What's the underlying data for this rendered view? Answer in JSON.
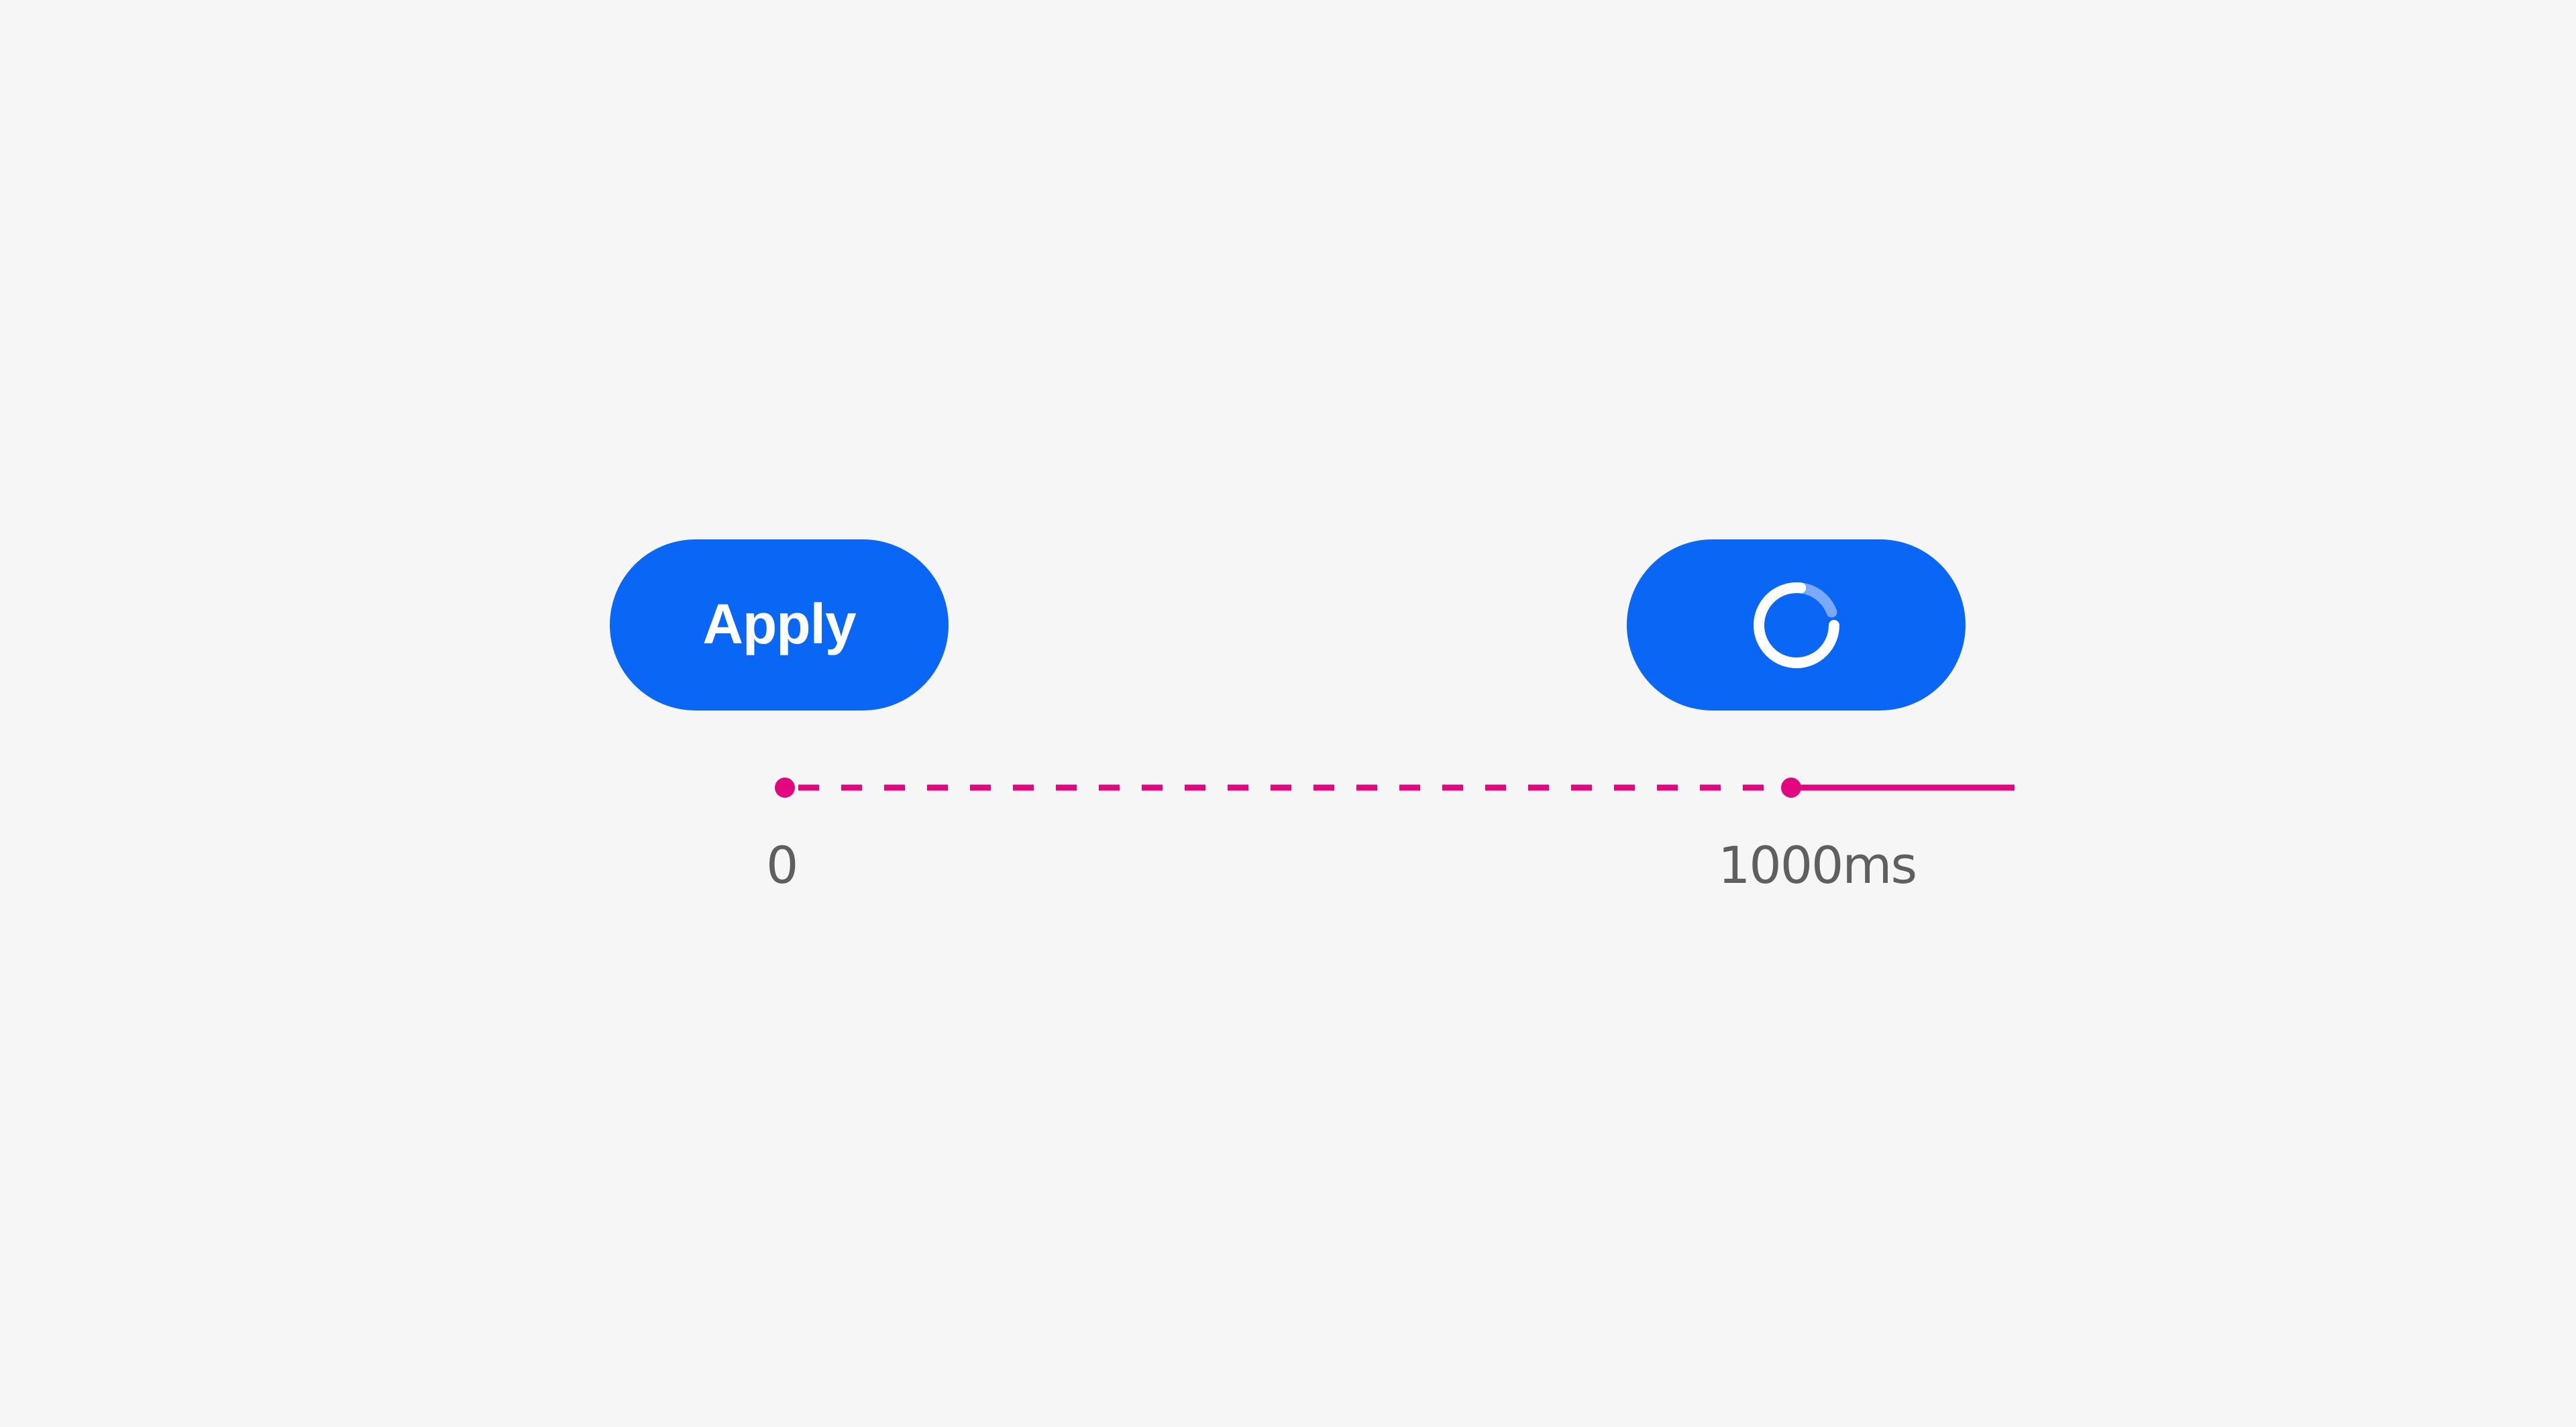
{
  "colors": {
    "background": "#f6f6f6",
    "button_fill": "#0a66f5",
    "button_text": "#ffffff",
    "spinner_track": "#7aa9f8",
    "spinner_arc": "#ffffff",
    "timeline": "#e3077f",
    "label_text": "#5f5f5f"
  },
  "buttons": {
    "apply": {
      "label": "Apply",
      "state": "default"
    },
    "loading": {
      "label": "",
      "state": "loading",
      "icon": "spinner-icon"
    }
  },
  "timeline": {
    "unit": "ms",
    "start_value": 0,
    "end_value": 1000,
    "start_label": "0",
    "end_label": "1000ms",
    "segments": [
      {
        "from": 0,
        "to": 1000,
        "style": "dashed",
        "meaning": "waiting"
      },
      {
        "from": 1000,
        "to": null,
        "style": "solid",
        "meaning": "loading"
      }
    ]
  }
}
